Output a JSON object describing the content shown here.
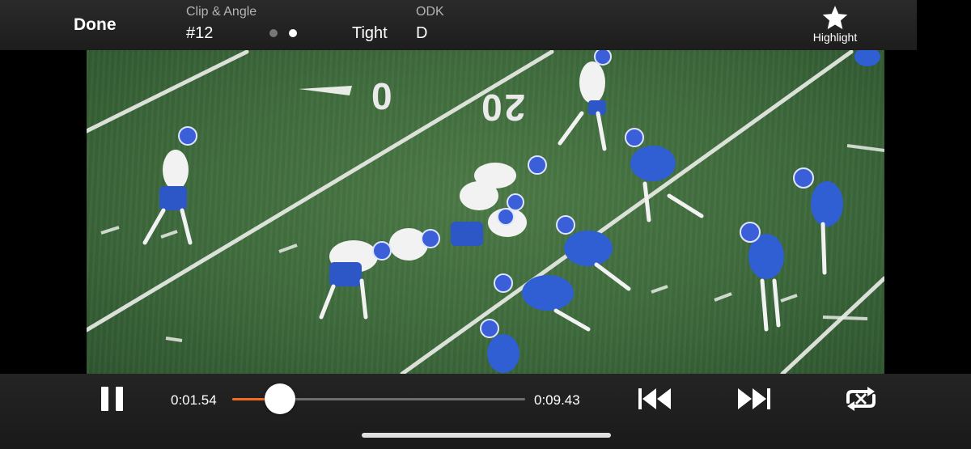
{
  "header": {
    "done_label": "Done",
    "clip_title": "Clip & Angle",
    "clip_number": "#12",
    "angle_label": "Tight",
    "odk_title": "ODK",
    "odk_value": "D",
    "highlight_label": "Highlight",
    "pager": {
      "total": 2,
      "active": 2
    }
  },
  "video": {
    "field_numbers": [
      "0",
      "20"
    ]
  },
  "playback": {
    "current_time": "0:01.54",
    "total_time": "0:09.43",
    "progress": 0.163,
    "accent_color": "#f26b21"
  },
  "icons": {
    "star": "star-icon",
    "pause": "pause-icon",
    "rewind": "skip-back-icon",
    "forward": "skip-forward-icon",
    "loop": "loop-icon"
  }
}
